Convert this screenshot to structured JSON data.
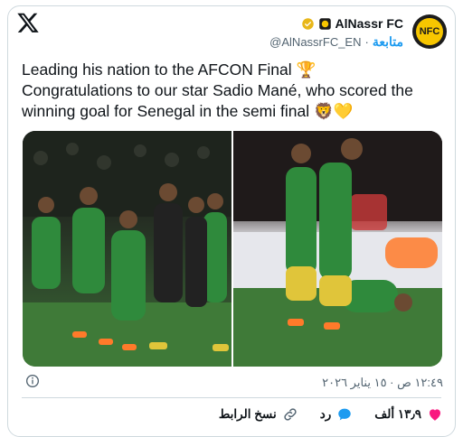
{
  "header": {
    "account_name": "AlNassr FC",
    "handle": "@AlNassrFC_EN",
    "follow_label": "متابعة",
    "separator": "·",
    "avatar_text": "NFC"
  },
  "tweet": {
    "line1": "Leading his nation to the AFCON Final 🏆",
    "line2": "Congratulations to our star Sadio Mané, who scored the",
    "line3": "winning goal for Senegal in the semi final 🦁💛"
  },
  "footer": {
    "timestamp": "١٢:٤٩ ص · ١٥ يناير ٢٠٢٦"
  },
  "actions": {
    "like_count": "١٣٫٩ ألف",
    "reply_label": "رد",
    "copy_link_label": "نسخ الرابط"
  },
  "colors": {
    "accent": "#1d9bf0",
    "like": "#f91880",
    "verified": "#e8b71a"
  }
}
